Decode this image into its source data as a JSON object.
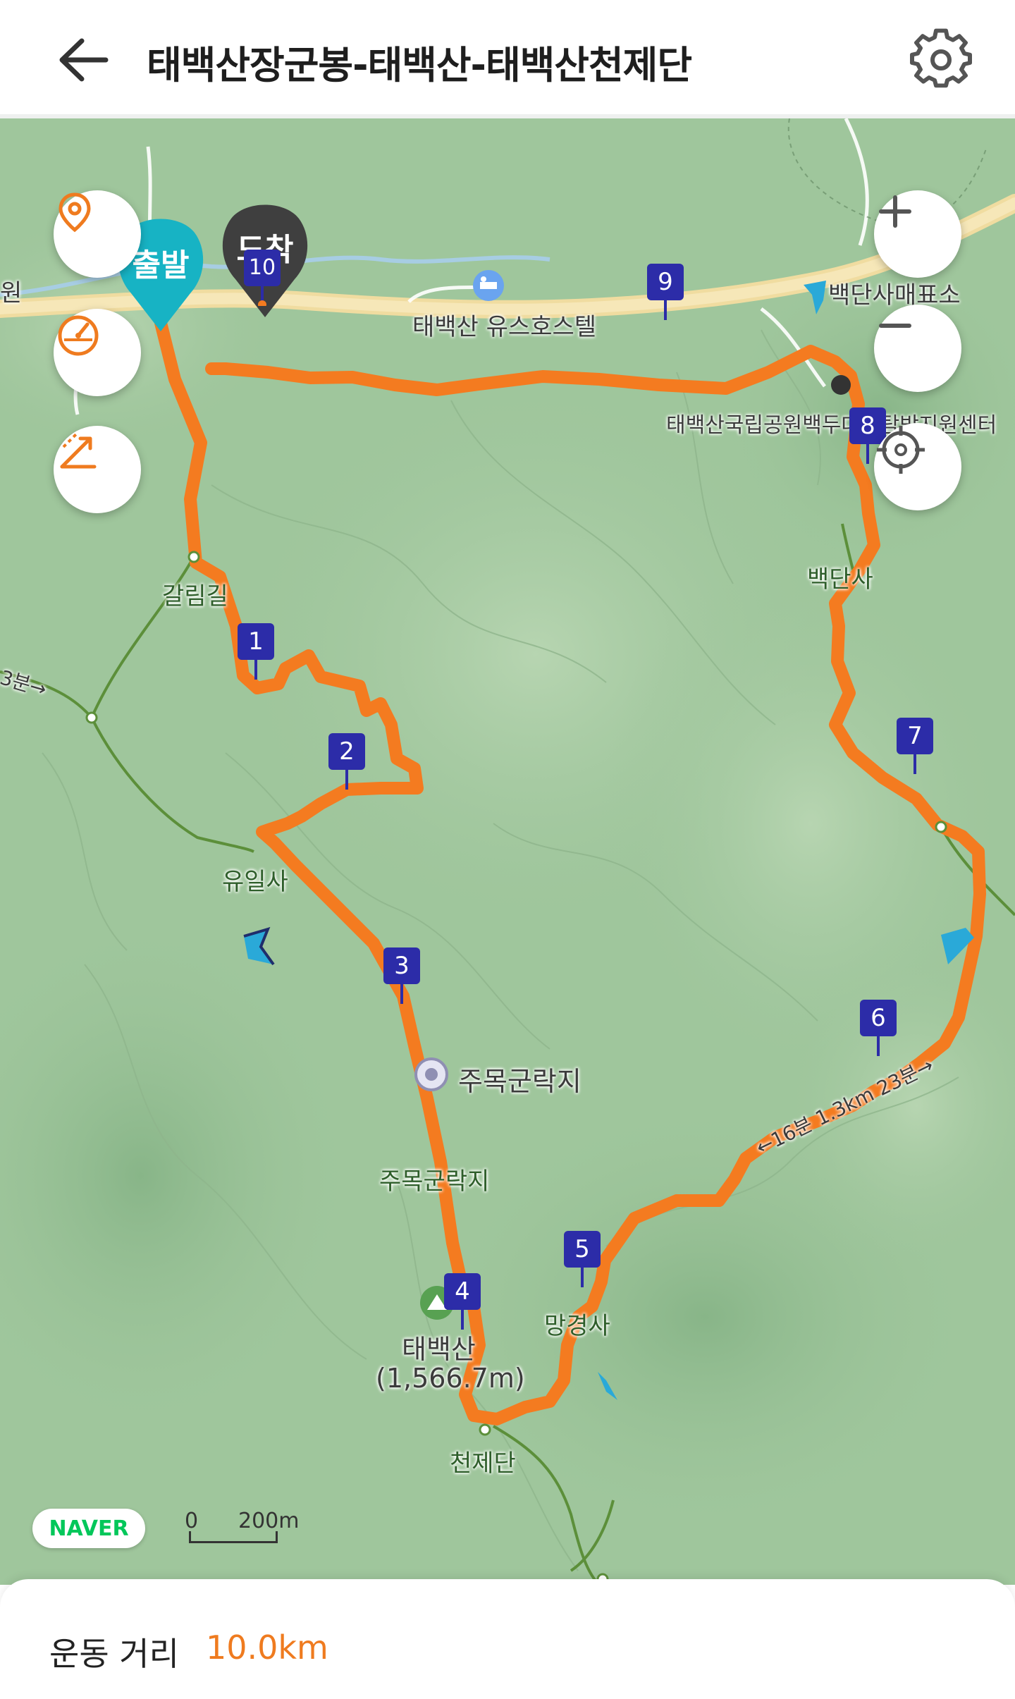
{
  "header": {
    "title": "태백산장군봉-태백산-태백산천제단",
    "back_icon": "arrow-left-icon",
    "settings_icon": "gear-icon"
  },
  "map": {
    "controls": {
      "left": [
        "map-pin-icon",
        "speedometer-icon",
        "slope-icon"
      ],
      "right": [
        "zoom-in-icon",
        "zoom-out-icon",
        "locate-icon"
      ]
    },
    "start_label": "출발",
    "end_label": "도착",
    "waypoints": [
      "1",
      "2",
      "3",
      "4",
      "5",
      "6",
      "7",
      "8",
      "9",
      "10"
    ],
    "places": {
      "galrimgol": "갈림길",
      "yuilsa": "유일사",
      "jumokgun": "주목군락지",
      "jumokgun2": "주목군락지",
      "taebaeksan": "태백산",
      "elevation": "(1,566.7m)",
      "cheonjedan": "천제단",
      "manggyeongsa": "망경사",
      "baekdansa": "백단사",
      "baekdansa_ticket": "백단사매표소",
      "park_center": "태백산국립공원백두대간탐방지원센터",
      "hostel": "태백산 유스호스텔",
      "trail_left": "3분→",
      "trail_right": "←16분 1.3km 23분→",
      "left_edge": "원"
    },
    "colors": {
      "route": "#f47b20",
      "start": "#17b3c4",
      "end": "#3f3f3f",
      "waypoint": "#2c2ca8"
    },
    "attribution": "NAVER",
    "scale": {
      "zero": "0",
      "label": "200m"
    }
  },
  "summary": {
    "distance_label": "운동 거리",
    "distance_value": "10.0km"
  }
}
